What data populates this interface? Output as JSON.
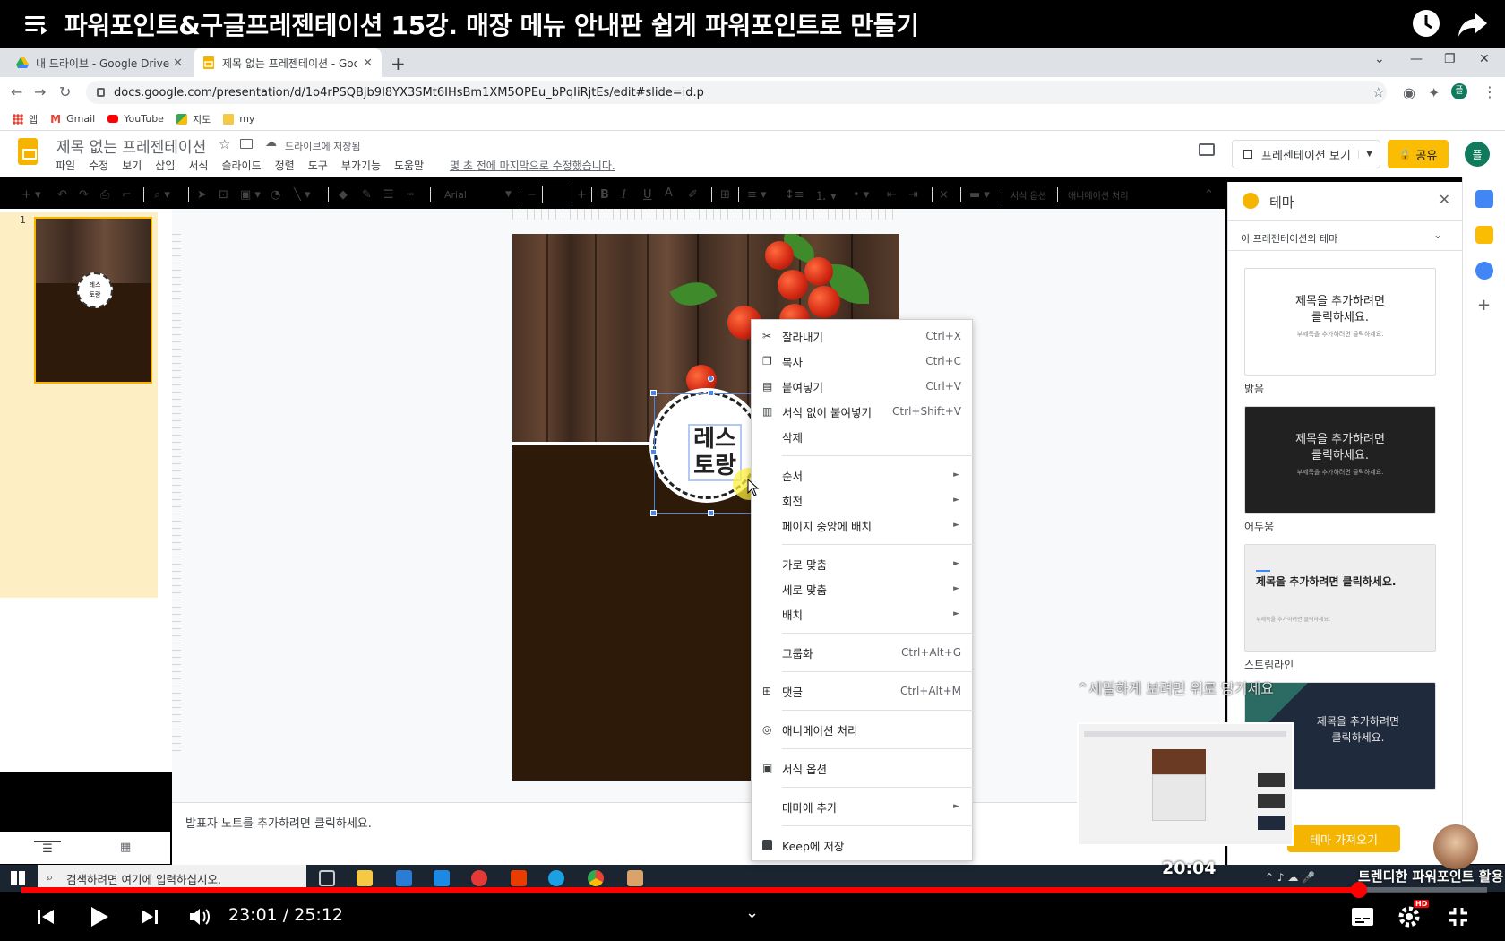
{
  "youtube": {
    "video_title": "파워포인트&구글프레젠테이션 15강. 매장 메뉴 안내판 쉽게 파워포인트로 만들기",
    "time_current": "23:01",
    "time_total": "25:12",
    "time_display": "23:01 / 25:12",
    "progress_fraction": 0.9126,
    "preview_time": "20:04",
    "tooltip": "세밀하게 보려면 위로 당기세요",
    "chapter": "트렌디한 파워포인트 활용",
    "hd_badge": "HD"
  },
  "browser": {
    "tabs": [
      {
        "label": "내 드라이브 - Google Drive",
        "icon": "google-drive-icon"
      },
      {
        "label": "제목 없는 프레젠테이션 - Goog",
        "icon": "google-slides-icon",
        "active": true
      }
    ],
    "url": "docs.google.com/presentation/d/1o4rPSQBjb9I8YX3SMt6IHsBm1XM5OPEu_bPqIiRjtEs/edit#slide=id.p",
    "bookmarks": [
      "앱",
      "Gmail",
      "YouTube",
      "지도",
      "my"
    ]
  },
  "slides": {
    "doc_title": "제목 없는 프레젠테이션",
    "save_status": "드라이브에 저장됨",
    "menus": [
      "파일",
      "수정",
      "보기",
      "삽입",
      "서식",
      "슬라이드",
      "정렬",
      "도구",
      "부가기능",
      "도움말"
    ],
    "last_edit": "몇 초 전에 마지막으로 수정했습니다.",
    "present_label": "프레젠테이션 보기",
    "share_label": "공유",
    "avatar_letter": "플",
    "toolbar": {
      "font": "Arial",
      "format_options": "서식 옵션",
      "animate": "애니메이션 처리"
    },
    "slide_number": "1",
    "badge_text": "레스\n토랑",
    "badge_line1": "레스",
    "badge_line2": "토랑",
    "notes_placeholder": "발표자 노트를 추가하려면 클릭하세요."
  },
  "theme_panel": {
    "title": "테마",
    "subtitle": "이 프레젠테이션의 테마",
    "themes": [
      {
        "name": "밝음",
        "title": "제목을 추가하려면\n클릭하세요.",
        "subtitle": "부제목을 추가하려면 클릭하세요."
      },
      {
        "name": "어두움",
        "title": "제목을 추가하려면\n클릭하세요.",
        "subtitle": "부제목을 추가하려면 클릭하세요."
      },
      {
        "name": "스트림라인",
        "title": "제목을 추가하려면 클릭하세요.",
        "subtitle": "부제목을 추가하려면 클릭하세요."
      },
      {
        "name": "",
        "title": "제목을 추가하려면\n클릭하세요.",
        "subtitle": ""
      }
    ],
    "import_label": "테마 가져오기"
  },
  "context_menu": [
    {
      "label": "잘라내기",
      "shortcut": "Ctrl+X",
      "icon": "scissors-icon"
    },
    {
      "label": "복사",
      "shortcut": "Ctrl+C",
      "icon": "copy-icon"
    },
    {
      "label": "붙여넣기",
      "shortcut": "Ctrl+V",
      "icon": "paste-icon"
    },
    {
      "label": "서식 없이 붙여넣기",
      "shortcut": "Ctrl+Shift+V",
      "icon": "paste-plain-icon"
    },
    {
      "label": "삭제",
      "shortcut": ""
    },
    {
      "label": "순서",
      "submenu": true
    },
    {
      "label": "회전",
      "submenu": true
    },
    {
      "label": "페이지 중앙에 배치",
      "submenu": true
    },
    {
      "label": "가로 맞춤",
      "submenu": true
    },
    {
      "label": "세로 맞춤",
      "submenu": true
    },
    {
      "label": "배치",
      "submenu": true
    },
    {
      "label": "그룹화",
      "shortcut": "Ctrl+Alt+G"
    },
    {
      "label": "댓글",
      "shortcut": "Ctrl+Alt+M",
      "icon": "comment-icon"
    },
    {
      "label": "애니메이션 처리",
      "icon": "animation-icon"
    },
    {
      "label": "서식 옵션",
      "icon": "format-options-icon"
    },
    {
      "label": "테마에 추가",
      "submenu": true
    },
    {
      "label": "Keep에 저장",
      "icon": "keep-icon"
    }
  ],
  "taskbar": {
    "search_placeholder": "검색하려면 여기에 입력하십시오."
  },
  "colors": {
    "slides_yellow": "#f4b400",
    "youtube_red": "#ff0000",
    "slide_brown": "#2e1a08"
  }
}
